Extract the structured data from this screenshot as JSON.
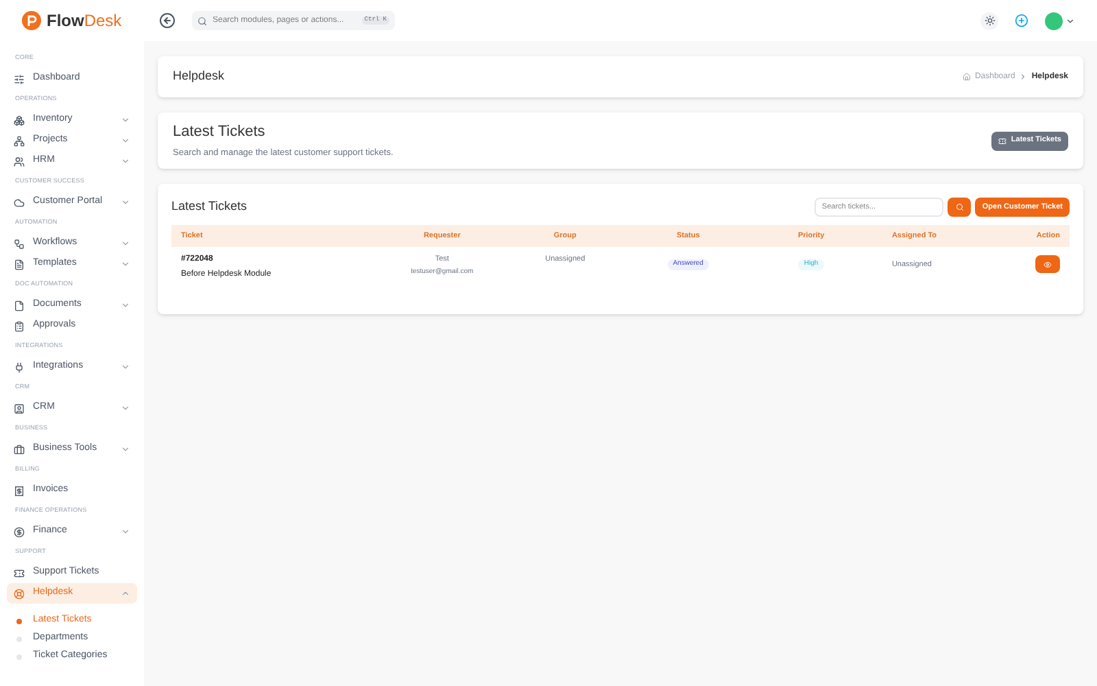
{
  "brand": {
    "part_1": "Flow",
    "part_2": "Desk"
  },
  "search": {
    "placeholder": "Search modules, pages or actions...",
    "shortcut": "Ctrl K"
  },
  "sidebar": {
    "sections": [
      {
        "heading": "CORE",
        "items": [
          {
            "label": "Dashboard",
            "kind": "link",
            "selected": false
          }
        ]
      },
      {
        "heading": "OPERATIONS",
        "items": [
          {
            "label": "Inventory",
            "kind": "group",
            "expanded": false,
            "selected": false
          },
          {
            "label": "Projects",
            "kind": "group",
            "expanded": false,
            "selected": false
          },
          {
            "label": "HRM",
            "kind": "group",
            "expanded": false,
            "selected": false
          }
        ]
      },
      {
        "heading": "CUSTOMER SUCCESS",
        "items": [
          {
            "label": "Customer Portal",
            "kind": "group",
            "expanded": false,
            "selected": false
          }
        ]
      },
      {
        "heading": "AUTOMATION",
        "items": [
          {
            "label": "Workflows",
            "kind": "group",
            "expanded": false,
            "selected": false
          },
          {
            "label": "Templates",
            "kind": "group",
            "expanded": false,
            "selected": false
          }
        ]
      },
      {
        "heading": "DOC AUTOMATION",
        "items": [
          {
            "label": "Documents",
            "kind": "group",
            "expanded": false,
            "selected": false
          },
          {
            "label": "Approvals",
            "kind": "link",
            "selected": false
          }
        ]
      },
      {
        "heading": "INTEGRATIONS",
        "items": [
          {
            "label": "Integrations",
            "kind": "group",
            "expanded": false,
            "selected": false
          }
        ]
      },
      {
        "heading": "CRM",
        "items": [
          {
            "label": "CRM",
            "kind": "group",
            "expanded": false,
            "selected": false
          }
        ]
      },
      {
        "heading": "BUSINESS",
        "items": [
          {
            "label": "Business Tools",
            "kind": "group",
            "expanded": false,
            "selected": false
          }
        ]
      },
      {
        "heading": "BILLING",
        "items": [
          {
            "label": "Invoices",
            "kind": "link",
            "selected": false
          }
        ]
      },
      {
        "heading": "FINANCE OPERATIONS",
        "items": [
          {
            "label": "Finance",
            "kind": "group",
            "expanded": false,
            "selected": false
          }
        ]
      },
      {
        "heading": "SUPPORT",
        "items": [
          {
            "label": "Support Tickets",
            "kind": "link",
            "selected": false
          },
          {
            "label": "Helpdesk",
            "kind": "group",
            "expanded": true,
            "selected": true,
            "children": [
              {
                "label": "Latest Tickets",
                "selected": true
              },
              {
                "label": "Departments",
                "selected": false
              },
              {
                "label": "Ticket Categories",
                "selected": false
              }
            ]
          }
        ]
      }
    ]
  },
  "page_header": {
    "title": "Helpdesk",
    "breadcrumb": [
      {
        "label": "Dashboard"
      },
      {
        "label": "Helpdesk"
      }
    ]
  },
  "intro": {
    "title": "Latest Tickets",
    "subtitle": "Search and manage the latest customer support tickets.",
    "button": "Latest Tickets"
  },
  "tickets": {
    "title": "Latest Tickets",
    "search_placeholder": "Search tickets...",
    "open_button": "Open Customer Ticket",
    "columns": [
      "Ticket",
      "Requester",
      "Group",
      "Status",
      "Priority",
      "Assigned To",
      "Action"
    ],
    "rows": [
      {
        "number": "#722048",
        "subject": "Before Helpdesk Module",
        "requester": "Test",
        "email": "testuser@gmail.com",
        "group": "Unassigned",
        "status": "Answered",
        "priority": "High",
        "assigned_to": "Unassigned"
      }
    ]
  }
}
